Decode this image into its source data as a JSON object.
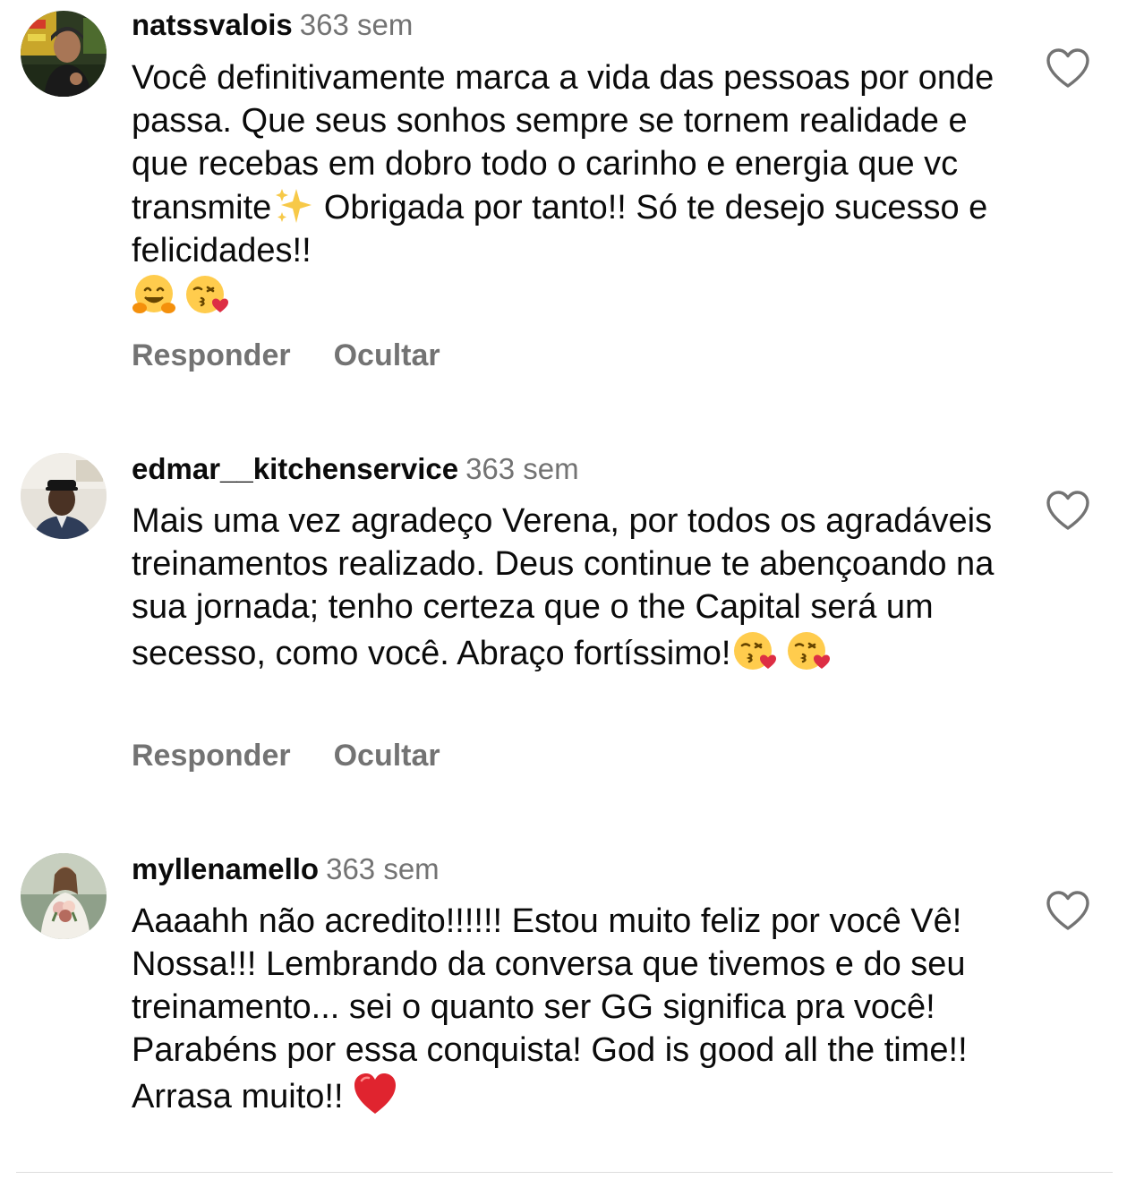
{
  "comments": [
    {
      "username": "natssvalois",
      "time": "363 sem",
      "text": "Você definitivamente marca a vida das pessoas por onde passa. Que seus sonhos sempre se tornem realidade e que recebas em dobro todo o carinho e energia que vc transmite",
      "text_after_sparkles": " Obrigada por tanto!! Só te desejo sucesso e felicidades!!",
      "emojis": [
        "hugging-face",
        "face-blowing-kiss"
      ],
      "reply_label": "Responder",
      "hide_label": "Ocultar"
    },
    {
      "username": "edmar__kitchenservice",
      "time": "363 sem",
      "text": "Mais uma vez agradeço Verena, por todos os agradáveis treinamentos realizado. Deus continue te abençoando na sua jornada; tenho certeza que o the Capital será um secesso, como você. Abraço fortíssimo!",
      "emojis": [
        "face-blowing-kiss",
        "face-blowing-kiss"
      ],
      "reply_label": "Responder",
      "hide_label": "Ocultar"
    },
    {
      "username": "myllenamello",
      "time": "363 sem",
      "text": "Aaaahh não acredito!!!!!! Estou muito feliz por você Vê! Nossa!!! Lembrando da conversa que tivemos e do seu treinamento... sei o quanto ser GG significa pra você! Parabéns por essa conquista! God is good all the time!! Arrasa muito!!",
      "emojis": [
        "red-heart"
      ]
    }
  ],
  "colors": {
    "text": "#0b0b0b",
    "muted": "#737373",
    "divider": "#dcdcdc"
  }
}
